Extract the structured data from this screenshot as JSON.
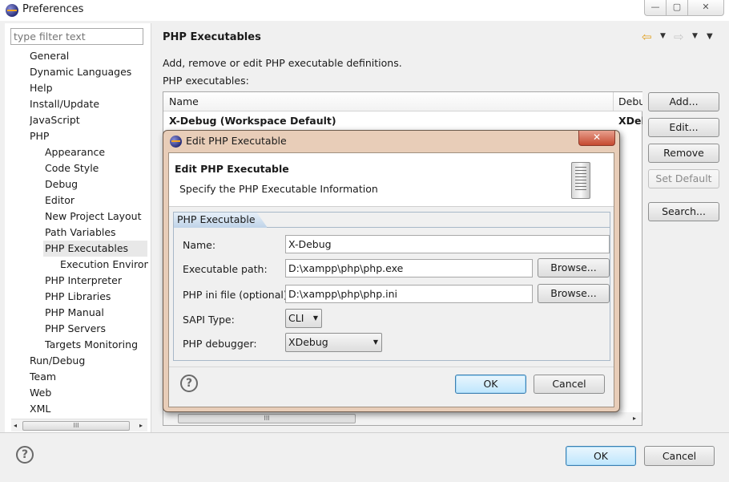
{
  "window": {
    "title": "Preferences",
    "app_icon": "eclipse-icon",
    "controls": {
      "minimize": "—",
      "maximize": "▢",
      "close": "✕"
    }
  },
  "sidebar": {
    "filter_placeholder": "type filter text",
    "items": [
      {
        "label": "General",
        "level": 0
      },
      {
        "label": "Dynamic Languages",
        "level": 0
      },
      {
        "label": "Help",
        "level": 0
      },
      {
        "label": "Install/Update",
        "level": 0
      },
      {
        "label": "JavaScript",
        "level": 0
      },
      {
        "label": "PHP",
        "level": 0
      },
      {
        "label": "Appearance",
        "level": 1
      },
      {
        "label": "Code Style",
        "level": 1
      },
      {
        "label": "Debug",
        "level": 1
      },
      {
        "label": "Editor",
        "level": 1
      },
      {
        "label": "New Project Layout",
        "level": 1
      },
      {
        "label": "Path Variables",
        "level": 1
      },
      {
        "label": "PHP Executables",
        "level": 1,
        "selected": true
      },
      {
        "label": "Execution Environ",
        "level": 2
      },
      {
        "label": "PHP Interpreter",
        "level": 1
      },
      {
        "label": "PHP Libraries",
        "level": 1
      },
      {
        "label": "PHP Manual",
        "level": 1
      },
      {
        "label": "PHP Servers",
        "level": 1
      },
      {
        "label": "Targets Monitoring",
        "level": 1
      },
      {
        "label": "Run/Debug",
        "level": 0
      },
      {
        "label": "Team",
        "level": 0
      },
      {
        "label": "Web",
        "level": 0
      },
      {
        "label": "XML",
        "level": 0
      }
    ],
    "scroll_left": "◂",
    "scroll_right": "▸",
    "scroll_grip": "III"
  },
  "page": {
    "title": "PHP Executables",
    "description": "Add, remove or edit PHP executable definitions.",
    "table_label": "PHP executables:",
    "nav": {
      "back": "⇦",
      "forward": "⇨",
      "dropdown": "▼",
      "menu": "▼"
    },
    "table": {
      "columns": [
        "Name",
        "Debu"
      ],
      "rows": [
        {
          "name": "X-Debug (Workspace Default)",
          "debugger": "XDel"
        }
      ],
      "scroll_grip": "III",
      "scroll_right": "▸"
    },
    "buttons": {
      "add": "Add...",
      "edit": "Edit...",
      "remove": "Remove",
      "set_default": "Set Default",
      "search": "Search..."
    }
  },
  "footer": {
    "help": "?",
    "ok": "OK",
    "cancel": "Cancel"
  },
  "dialog": {
    "title": "Edit PHP Executable",
    "close": "✕",
    "heading": "Edit PHP Executable",
    "subheading": "Specify the PHP Executable Information",
    "tab": "PHP Executable",
    "fields": {
      "name_label": "Name:",
      "name_value": "X-Debug",
      "exec_label": "Executable path:",
      "exec_value": "D:\\xampp\\php\\php.exe",
      "ini_label": "PHP ini file (optional):",
      "ini_value": "D:\\xampp\\php\\php.ini",
      "sapi_label": "SAPI Type:",
      "sapi_value": "CLI",
      "debugger_label": "PHP debugger:",
      "debugger_value": "XDebug"
    },
    "browse": "Browse...",
    "help": "?",
    "ok": "OK",
    "cancel": "Cancel"
  }
}
